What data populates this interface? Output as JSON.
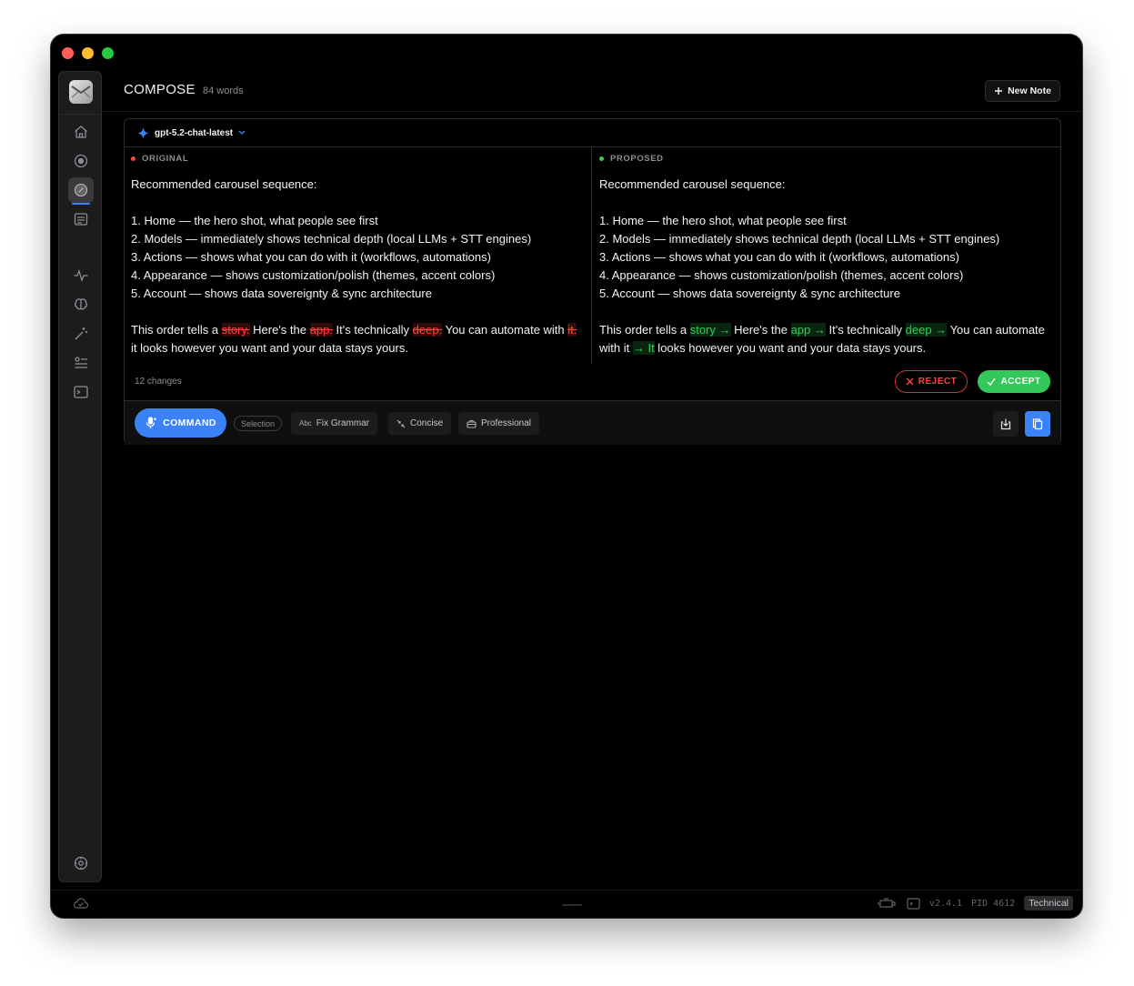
{
  "window": {
    "traffic_lights": [
      "close",
      "minimize",
      "zoom"
    ]
  },
  "sidebar": {
    "items": [
      {
        "icon": "home-icon"
      },
      {
        "icon": "record-icon"
      },
      {
        "icon": "compose-icon",
        "active": true
      },
      {
        "icon": "notes-icon"
      },
      {
        "icon": "activity-icon"
      },
      {
        "icon": "brain-icon"
      },
      {
        "icon": "magic-wand-icon"
      },
      {
        "icon": "list-settings-icon"
      },
      {
        "icon": "terminal-icon"
      }
    ],
    "bottom_icon": "settings-icon"
  },
  "header": {
    "title": "COMPOSE",
    "word_count": "84 words",
    "new_note_label": "New Note"
  },
  "model": {
    "name": "gpt-5.2-chat-latest"
  },
  "original": {
    "heading": "ORIGINAL",
    "line1": "Recommended carousel sequence:",
    "list": [
      "1. Home — the hero shot, what people see first",
      "2. Models — immediately shows technical depth (local LLMs + STT engines)",
      "3. Actions — shows what you can do with it (workflows, automations)",
      "4. Appearance — shows customization/polish (themes, accent colors)",
      "5. Account — shows data sovereignty & sync architecture"
    ],
    "para": {
      "t1": "This order tells a ",
      "d1": "story.",
      "t2": " Here's the ",
      "d2": "app.",
      "t3": " It's technically ",
      "d3": "deep.",
      "t4": " You can automate with ",
      "d4": "it.",
      "t5": " it looks however you want and your data stays yours."
    }
  },
  "proposed": {
    "heading": "PROPOSED",
    "line1": "Recommended carousel sequence:",
    "list": [
      "1. Home — the hero shot, what people see first",
      "2. Models — immediately shows technical depth (local LLMs + STT engines)",
      "3. Actions — shows what you can do with it (workflows, automations)",
      "4. Appearance — shows customization/polish (themes, accent colors)",
      "5. Account — shows data sovereignty & sync architecture"
    ],
    "para": {
      "t1": "This order tells a ",
      "i1": "story →",
      "t2": " Here's the ",
      "i2": "app →",
      "t3": " It's technically ",
      "i3": "deep →",
      "t4": " You can automate with it ",
      "i4": "→ It",
      "t5": " looks however you want and your data stays yours."
    }
  },
  "review": {
    "changes": "12 changes",
    "reject_label": "REJECT",
    "accept_label": "ACCEPT"
  },
  "toolbar": {
    "command_label": "COMMAND",
    "selection_chip": "Selection",
    "fix_grammar_prefix": "Abc",
    "fix_grammar_label": "Fix Grammar",
    "concise_label": "Concise",
    "professional_label": "Professional"
  },
  "status": {
    "version": "v2.4.1",
    "pid": "PID 4612",
    "mode": "Technical"
  },
  "colors": {
    "accent": "#3b82f6",
    "accept": "#34c759",
    "reject": "#ff453a",
    "background": "#000000"
  }
}
